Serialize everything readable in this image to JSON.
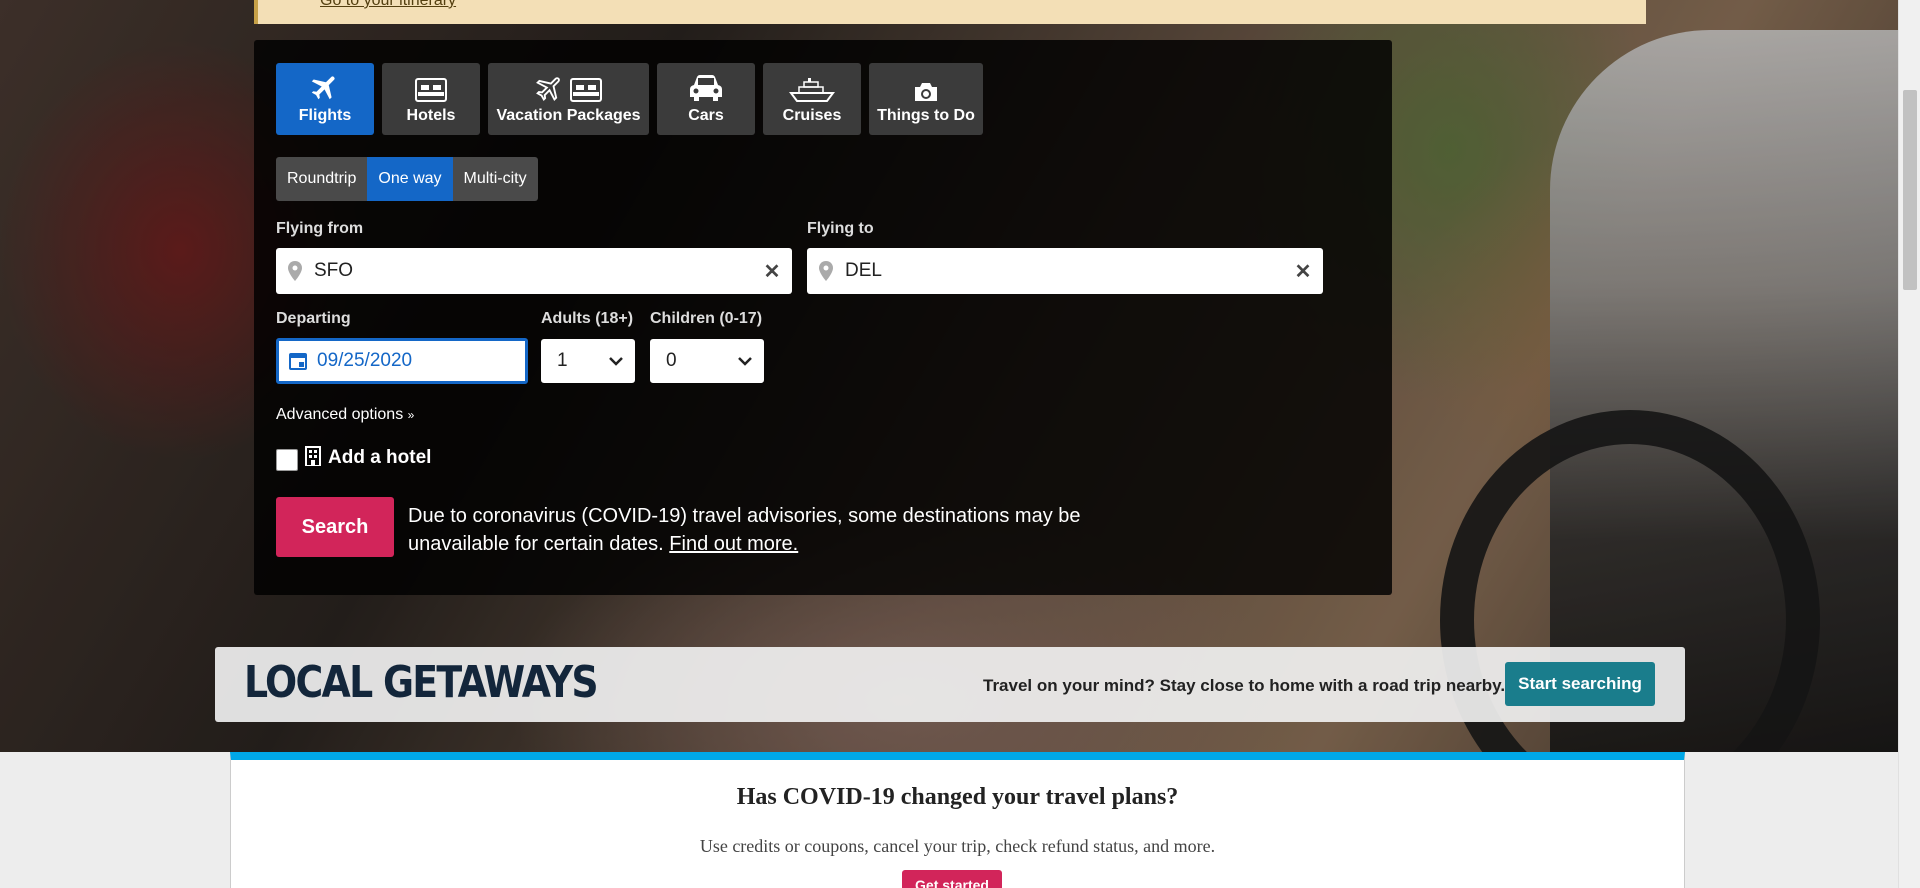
{
  "top_banner": {
    "link_text": "Go to your itinerary"
  },
  "tabs": [
    {
      "label": "Flights",
      "icon": "plane-icon",
      "active": true
    },
    {
      "label": "Hotels",
      "icon": "bed-icon",
      "active": false
    },
    {
      "label": "Vacation Packages",
      "icon": "plane-bed-icon",
      "active": false
    },
    {
      "label": "Cars",
      "icon": "car-icon",
      "active": false
    },
    {
      "label": "Cruises",
      "icon": "ship-icon",
      "active": false
    },
    {
      "label": "Things to Do",
      "icon": "camera-icon",
      "active": false
    }
  ],
  "trip_types": [
    {
      "label": "Roundtrip",
      "selected": false
    },
    {
      "label": "One way",
      "selected": true
    },
    {
      "label": "Multi-city",
      "selected": false
    }
  ],
  "flying_from": {
    "label": "Flying from",
    "value": "SFO"
  },
  "flying_to": {
    "label": "Flying to",
    "value": "DEL"
  },
  "departing": {
    "label": "Departing",
    "value": "09/25/2020"
  },
  "adults": {
    "label": "Adults (18+)",
    "value": "1"
  },
  "children": {
    "label": "Children (0-17)",
    "value": "0"
  },
  "advanced_options": "Advanced options",
  "add_hotel": "Add a hotel",
  "search_button": "Search",
  "notice": {
    "text": "Due to coronavirus (COVID-19) travel advisories, some destinations may be unavailable for certain dates.",
    "link": "Find out more."
  },
  "getaways": {
    "brand": "LOCAL GETAWAYS",
    "message": "Travel on your mind? Stay close to home with a road trip nearby.",
    "button": "Start searching"
  },
  "covid_card": {
    "title": "Has COVID-19 changed your travel plans?",
    "subtitle": "Use credits or coupons, cancel your trip, check refund status, and more.",
    "button": "Get started"
  },
  "colors": {
    "accent_blue": "#1467c7",
    "search_pink": "#d2255a",
    "teal_button": "#1a7d8c",
    "banner_yellow": "#f3dfb6"
  }
}
